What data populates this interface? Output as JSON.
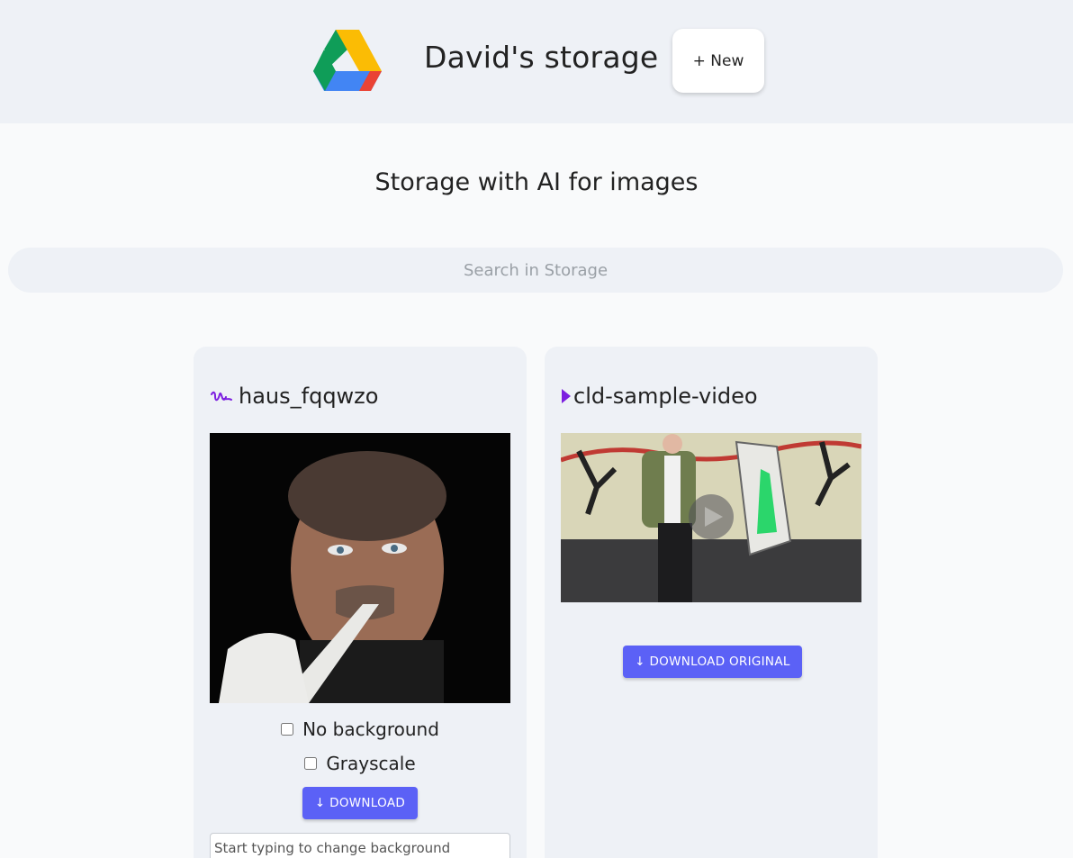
{
  "header": {
    "logo_icon": "google-drive-icon",
    "title": "David's storage",
    "new_button": "+ New"
  },
  "main": {
    "subtitle": "Storage with AI for images",
    "search_placeholder": "Search in Storage"
  },
  "files": [
    {
      "type_icon": "image-signature-icon",
      "name": "haus_fqqwzo",
      "options": [
        {
          "label": "No background",
          "checked": false
        },
        {
          "label": "Grayscale",
          "checked": false
        }
      ],
      "download_label": "↓ DOWNLOAD",
      "background_placeholder": "Start typing to change background"
    },
    {
      "type_icon": "play-video-icon",
      "name": "cld-sample-video",
      "download_label": "↓ DOWNLOAD ORIGINAL"
    }
  ],
  "colors": {
    "accent": "#5b61f6",
    "header_bg": "#eef1f6",
    "page_bg": "#f9fafb",
    "video_icon": "#7c1fe0"
  }
}
